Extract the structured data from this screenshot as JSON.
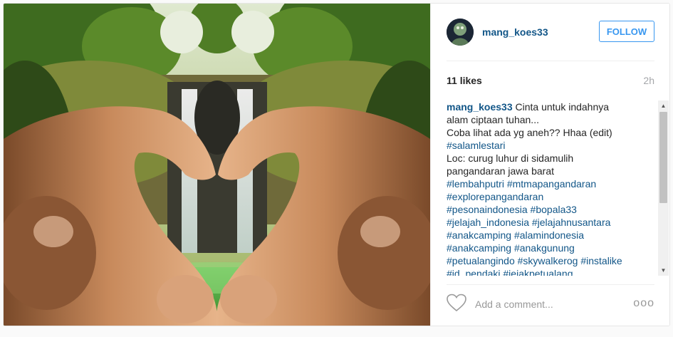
{
  "post": {
    "username": "mang_koes33",
    "follow_label": "FOLLOW",
    "likes": "11 likes",
    "time": "2h",
    "caption_author": "mang_koes33",
    "caption_lines": [
      "Cinta untuk indahnya",
      "alam ciptaan tuhan...",
      "Coba lihat ada yg aneh?? Hhaa (edit)",
      "#salamlestari",
      "Loc: curug luhur di sidamulih",
      "pangandaran jawa barat",
      "#lembahputri #mtmapangandaran",
      "#explorepangandaran",
      "#pesonaindonesia #bopala33",
      "#jelajah_indonesia #jelajahnusantara",
      "#anakcamping #alamindonesia",
      "#anakcamping #anakgunung",
      "#petualangindo #skywalkerog #instalike",
      "#id_pendaki #jejakpetualang"
    ],
    "comment_placeholder": "Add a comment...",
    "more_label": "ooo"
  },
  "icons": {
    "heart": "heart-icon",
    "more": "more-options-icon",
    "scroll_up": "scroll-up-arrow-icon",
    "scroll_down": "scroll-down-arrow-icon"
  },
  "colors": {
    "link": "#125688",
    "follow": "#3897f0",
    "muted": "#a5a7aa"
  }
}
